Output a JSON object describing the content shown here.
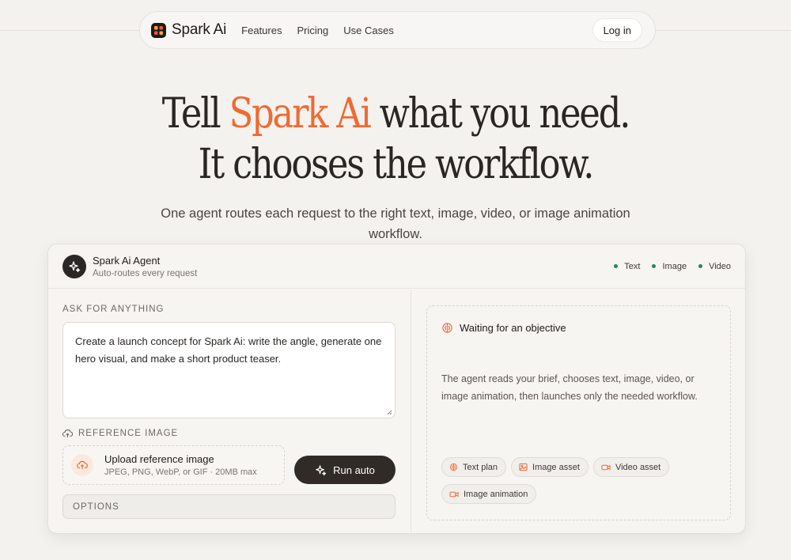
{
  "nav": {
    "brand": "Spark Ai",
    "links": [
      "Features",
      "Pricing",
      "Use Cases"
    ],
    "login_label": "Log in"
  },
  "hero": {
    "title_pre": "Tell ",
    "title_accent": "Spark Ai",
    "title_post": " what you need.",
    "title_line2": "It chooses the workflow.",
    "subtitle": "One agent routes each request to the right text, image, video, or image animation workflow.",
    "accent_color": "#ef6a32"
  },
  "agent": {
    "name": "Spark Ai Agent",
    "description": "Auto-routes every request",
    "modes": [
      "Text",
      "Image",
      "Video"
    ],
    "mode_dot_color": "#1f8a5c"
  },
  "ask": {
    "label": "ASK FOR ANYTHING",
    "prompt_value": "Create a launch concept for Spark Ai: write the angle, generate one hero visual, and make a short product teaser."
  },
  "reference": {
    "label": "REFERENCE IMAGE",
    "upload_title": "Upload reference image",
    "upload_hint": "JPEG, PNG, WebP, or GIF · 20MB max"
  },
  "run_button_label": "Run auto",
  "options_label": "OPTIONS",
  "status": {
    "title": "Waiting for an objective",
    "body": "The agent reads your brief, chooses text, image, video, or image animation, then launches only the needed workflow.",
    "chips": [
      {
        "label": "Text plan",
        "icon": "brain-icon"
      },
      {
        "label": "Image asset",
        "icon": "image-icon"
      },
      {
        "label": "Video asset",
        "icon": "video-icon"
      },
      {
        "label": "Image animation",
        "icon": "video-icon"
      }
    ]
  }
}
